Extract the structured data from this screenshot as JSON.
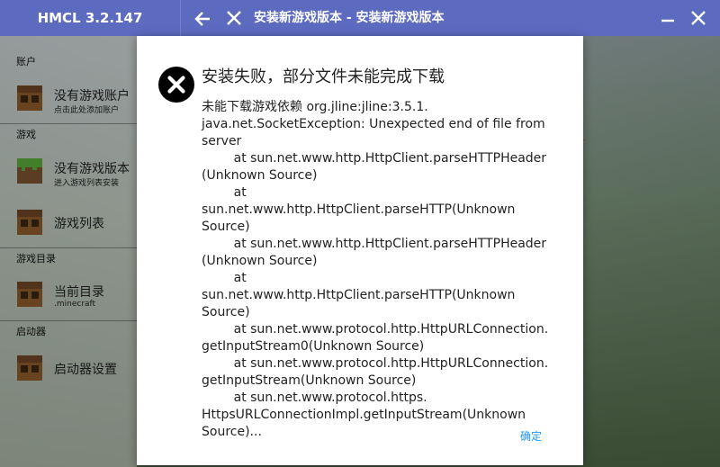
{
  "app": {
    "title": "HMCL 3.2.147"
  },
  "titlebar": {
    "page_title": "安装新游戏版本 - 安装新游戏版本",
    "icons": [
      "arrow-left-icon",
      "close-icon",
      "minimize-icon",
      "close-window-icon"
    ]
  },
  "sidebar": {
    "sections": {
      "account": "账户",
      "game": "游戏",
      "game_dir": "游戏目录",
      "launcher": "启动器"
    },
    "items": {
      "account": {
        "label": "没有游戏账户",
        "sub": "点击此处添加账户",
        "icon": "crafting-table-icon"
      },
      "version": {
        "label": "没有游戏版本",
        "sub": "进入游戏列表安装",
        "icon": "grass-block-icon"
      },
      "game_list": {
        "label": "游戏列表",
        "icon": "crafting-table-icon"
      },
      "current_dir": {
        "label": "当前目录",
        "sub": ".minecraft",
        "icon": "crafting-table-icon"
      },
      "settings": {
        "label": "启动器设置",
        "icon": "crafting-table-icon"
      }
    }
  },
  "dialog": {
    "heading": "安装失败，部分文件未能完成下载",
    "message": "未能下载游戏依赖 org.jline:jline:3.5.1.\njava.net.SocketException: Unexpected end of file from server\n        at sun.net.www.http.HttpClient.parseHTTPHeader (Unknown Source)\n        at sun.net.www.http.HttpClient.parseHTTP(Unknown Source)\n        at sun.net.www.http.HttpClient.parseHTTPHeader (Unknown Source)\n        at sun.net.www.http.HttpClient.parseHTTP(Unknown Source)\n        at sun.net.www.protocol.http.HttpURLConnection. getInputStream0(Unknown Source)\n        at sun.net.www.protocol.http.HttpURLConnection. getInputStream(Unknown Source)\n        at sun.net.www.protocol.https. HttpsURLConnectionImpl.getInputStream(Unknown Source)...",
    "ok_label": "确定",
    "icon": "error-x-icon"
  },
  "colors": {
    "titlebar": "#5c6bc0",
    "accent": "#2196f3",
    "error": "#000000"
  }
}
